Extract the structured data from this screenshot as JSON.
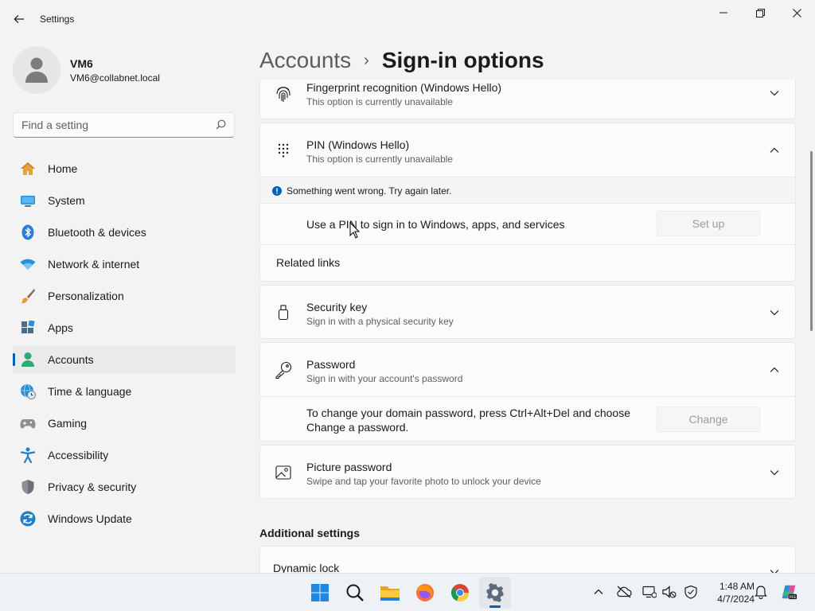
{
  "window": {
    "title": "Settings"
  },
  "user": {
    "name": "VM6",
    "email": "VM6@collabnet.local"
  },
  "search": {
    "placeholder": "Find a setting"
  },
  "sidebar": {
    "items": [
      {
        "label": "Home",
        "icon": "home-icon"
      },
      {
        "label": "System",
        "icon": "system-icon"
      },
      {
        "label": "Bluetooth & devices",
        "icon": "bluetooth-icon"
      },
      {
        "label": "Network & internet",
        "icon": "network-icon"
      },
      {
        "label": "Personalization",
        "icon": "brush-icon"
      },
      {
        "label": "Apps",
        "icon": "apps-icon"
      },
      {
        "label": "Accounts",
        "icon": "accounts-icon",
        "selected": true
      },
      {
        "label": "Time & language",
        "icon": "globe-clock-icon"
      },
      {
        "label": "Gaming",
        "icon": "gamepad-icon"
      },
      {
        "label": "Accessibility",
        "icon": "accessibility-icon"
      },
      {
        "label": "Privacy & security",
        "icon": "shield-icon"
      },
      {
        "label": "Windows Update",
        "icon": "update-icon"
      }
    ]
  },
  "breadcrumb": {
    "parent": "Accounts",
    "separator": "›",
    "current": "Sign-in options"
  },
  "main": {
    "fingerprint": {
      "title": "Fingerprint recognition (Windows Hello)",
      "subtitle": "This option is currently unavailable"
    },
    "pin": {
      "title": "PIN (Windows Hello)",
      "subtitle": "This option is currently unavailable",
      "error": "Something went wrong. Try again later.",
      "description": "Use a PIN to sign in to Windows, apps, and services",
      "button": "Set up",
      "related_links": "Related links"
    },
    "security_key": {
      "title": "Security key",
      "subtitle": "Sign in with a physical security key"
    },
    "password": {
      "title": "Password",
      "subtitle": "Sign in with your account's password",
      "description_line1": "To change your domain password, press Ctrl+Alt+Del and choose",
      "description_line2": "Change a password.",
      "button": "Change"
    },
    "picture_password": {
      "title": "Picture password",
      "subtitle": "Swipe and tap your favorite photo to unlock your device"
    },
    "additional_settings": {
      "heading": "Additional settings",
      "dynamic_lock": "Dynamic lock"
    }
  },
  "taskbar": {
    "apps": [
      "start",
      "search",
      "file-explorer",
      "firefox",
      "chrome",
      "settings"
    ],
    "time": "1:48 AM",
    "date": "4/7/2024"
  },
  "colors": {
    "accent": "#005fb8",
    "background": "#f3f3f3",
    "card": "#fbfbfb"
  }
}
